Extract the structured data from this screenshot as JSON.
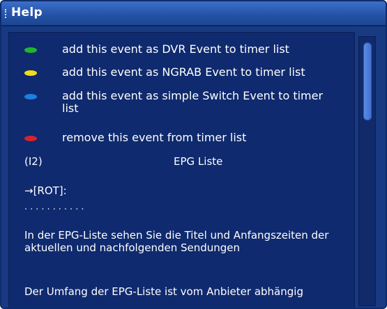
{
  "window": {
    "title": "Help"
  },
  "legend": [
    {
      "color": "#22b52f",
      "label": "add this event as DVR Event to timer list"
    },
    {
      "color": "#f2dc1a",
      "label": "add this event as NGRAB Event to timer list"
    },
    {
      "color": "#1f7fe0",
      "label": "add this event as simple Switch Event to timer list"
    },
    {
      "color": "#d3232c",
      "label": "remove this event from timer list"
    }
  ],
  "section": {
    "index": "(I2)",
    "heading": "EPG Liste",
    "key_line": "→[ROT]:",
    "dots": "...........",
    "paragraph1": "In der EPG-Liste sehen Sie die Titel und Anfangszeiten der aktuellen und nachfolgenden Sendungen",
    "paragraph2": "Der Umfang der EPG-Liste ist vom Anbieter abhängig"
  }
}
